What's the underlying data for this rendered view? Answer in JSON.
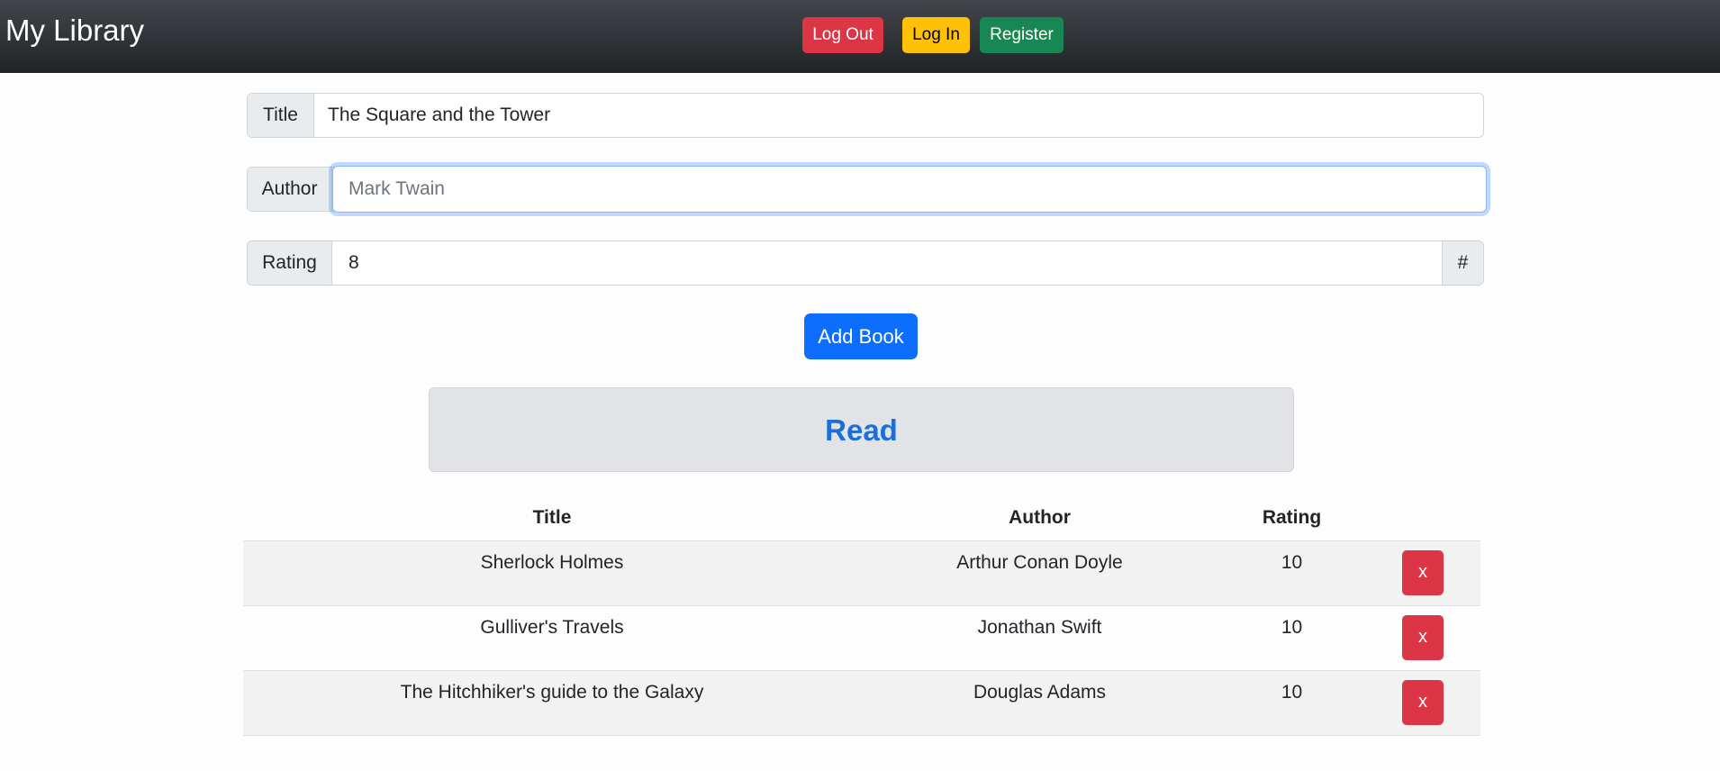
{
  "app": {
    "brand": "My Library"
  },
  "nav": {
    "logout_label": "Log Out",
    "login_label": "Log In",
    "register_label": "Register"
  },
  "form": {
    "title_label": "Title",
    "title_value": "The Square and the Tower",
    "author_label": "Author",
    "author_placeholder": "Mark Twain",
    "author_value": "",
    "rating_label": "Rating",
    "rating_value": "8",
    "rating_addon": "#",
    "add_button_label": "Add Book"
  },
  "read": {
    "heading": "Read",
    "columns": {
      "title": "Title",
      "author": "Author",
      "rating": "Rating"
    },
    "rows": [
      {
        "title": "Sherlock Holmes",
        "author": "Arthur Conan Doyle",
        "rating": "10",
        "delete_label": "x"
      },
      {
        "title": "Gulliver's Travels",
        "author": "Jonathan Swift",
        "rating": "10",
        "delete_label": "x"
      },
      {
        "title": "The Hitchhiker's guide to the Galaxy",
        "author": "Douglas Adams",
        "rating": "10",
        "delete_label": "x"
      }
    ]
  },
  "colors": {
    "navbar": "#212427",
    "danger": "#dc3545",
    "warning": "#ffc107",
    "success": "#198754",
    "primary": "#0d6efd",
    "read_heading": "#1c6ed9"
  }
}
